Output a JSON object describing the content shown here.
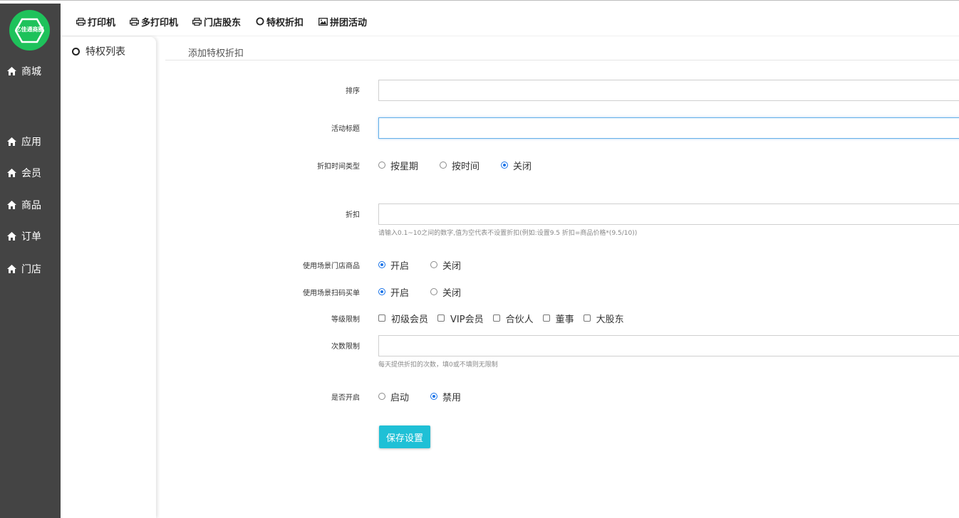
{
  "logo": {
    "text": "亿佳通商圈"
  },
  "sidebar": {
    "items": [
      {
        "label": "商城",
        "icon": "home-icon"
      },
      {
        "label": "应用",
        "icon": "home-icon"
      },
      {
        "label": "会员",
        "icon": "home-icon"
      },
      {
        "label": "商品",
        "icon": "home-icon"
      },
      {
        "label": "订单",
        "icon": "home-icon"
      },
      {
        "label": "门店",
        "icon": "home-icon"
      }
    ]
  },
  "topnav": {
    "items": [
      {
        "label": "打印机",
        "icon": "printer-icon"
      },
      {
        "label": "多打印机",
        "icon": "printer-icon"
      },
      {
        "label": "门店股东",
        "icon": "printer-icon"
      },
      {
        "label": "特权折扣",
        "icon": "circle-icon"
      },
      {
        "label": "拼团活动",
        "icon": "image-icon"
      }
    ]
  },
  "subnav": {
    "items": [
      {
        "label": "特权列表",
        "icon": "circle-icon"
      }
    ]
  },
  "tab": {
    "label": "添加特权折扣"
  },
  "form": {
    "sort": {
      "label": "排序",
      "value": ""
    },
    "title": {
      "label": "活动标题",
      "value": ""
    },
    "time_type": {
      "label": "折扣时间类型",
      "options": [
        "按星期",
        "按时间",
        "关闭"
      ],
      "selected": "关闭"
    },
    "discount": {
      "label": "折扣",
      "value": "",
      "help": "请输入0.1~10之间的数字,值为空代表不设置折扣(例如:设置9.5 折扣=商品价格*(9.5/10))"
    },
    "scene_store": {
      "label": "使用场景门店商品",
      "options": [
        "开启",
        "关闭"
      ],
      "selected": "开启"
    },
    "scene_scan": {
      "label": "使用场景扫码买单",
      "options": [
        "开启",
        "关闭"
      ],
      "selected": "开启"
    },
    "level": {
      "label": "等级限制",
      "options": [
        "初级会员",
        "VIP会员",
        "合伙人",
        "董事",
        "大股东"
      ]
    },
    "count": {
      "label": "次数限制",
      "value": "",
      "help": "每天提供折扣的次数，填0或不填则无限制"
    },
    "enabled": {
      "label": "是否开启",
      "options": [
        "启动",
        "禁用"
      ],
      "selected": "禁用"
    },
    "save_label": "保存设置"
  },
  "colors": {
    "sidebar": "#444444",
    "accent": "#1fc0d6",
    "logo": "#1ec25b",
    "radio": "#1a73e8"
  }
}
